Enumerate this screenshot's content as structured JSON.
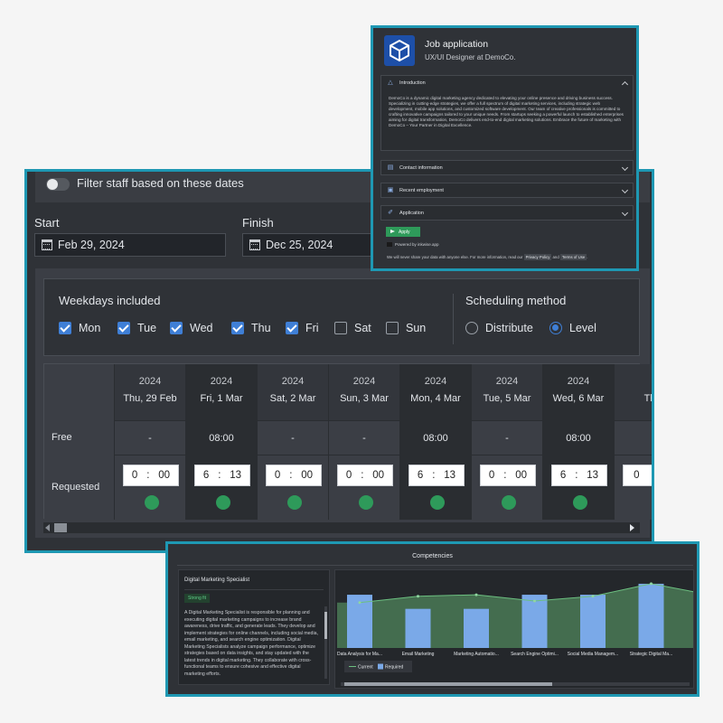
{
  "scheduler": {
    "filter_label": "Filter staff based on these dates",
    "start_label": "Start",
    "start_value": "Feb 29, 2024",
    "finish_label": "Finish",
    "finish_value": "Dec 25, 2024",
    "weekdays_title": "Weekdays included",
    "weekdays": [
      {
        "label": "Mon",
        "checked": true
      },
      {
        "label": "Tue",
        "checked": true
      },
      {
        "label": "Wed",
        "checked": true
      },
      {
        "label": "Thu",
        "checked": true
      },
      {
        "label": "Fri",
        "checked": true
      },
      {
        "label": "Sat",
        "checked": false
      },
      {
        "label": "Sun",
        "checked": false
      }
    ],
    "method_title": "Scheduling method",
    "methods": [
      {
        "label": "Distribute",
        "selected": false
      },
      {
        "label": "Level",
        "selected": true
      }
    ],
    "row_free": "Free",
    "row_requested": "Requested",
    "days": [
      {
        "year": "2024",
        "date": "Thu, 29 Feb",
        "free": "-",
        "h": "0",
        "m": "00"
      },
      {
        "year": "2024",
        "date": "Fri, 1 Mar",
        "free": "08:00",
        "h": "6",
        "m": "13"
      },
      {
        "year": "2024",
        "date": "Sat, 2 Mar",
        "free": "-",
        "h": "0",
        "m": "00"
      },
      {
        "year": "2024",
        "date": "Sun, 3 Mar",
        "free": "-",
        "h": "0",
        "m": "00"
      },
      {
        "year": "2024",
        "date": "Mon, 4 Mar",
        "free": "08:00",
        "h": "6",
        "m": "13"
      },
      {
        "year": "2024",
        "date": "Tue, 5 Mar",
        "free": "-",
        "h": "0",
        "m": "00"
      },
      {
        "year": "2024",
        "date": "Wed, 6 Mar",
        "free": "08:00",
        "h": "6",
        "m": "13"
      },
      {
        "year": "",
        "date": "Th",
        "free": "",
        "h": "0",
        "m": ""
      }
    ]
  },
  "job": {
    "title": "Job application",
    "subtitle": "UX/UI Designer at DemoCo.",
    "intro_title": "Introduction",
    "intro_text": "DemoCo is a dynamic digital marketing agency dedicated to elevating your online presence and driving business success. Specializing in cutting-edge strategies, we offer a full spectrum of digital marketing services, including strategic web development, mobile app solutions, and customized software development. Our team of creative professionals is committed to crafting innovative campaigns tailored to your unique needs. From startups seeking a powerful launch to established enterprises aiming for digital transformation, DemoCo delivers end-to-end digital marketing solutions. Embrace the future of marketing with DemoCo – Your Partner in Digital Excellence.",
    "sections": [
      "Contact information",
      "Recent employment",
      "Application"
    ],
    "apply_label": "Apply",
    "powered_by": "Powered by inkwise.app",
    "privacy_text": "We will never share your data with anyone else. For more information, read our",
    "privacy_link": "Privacy Policy",
    "and_text": "and",
    "terms_link": "Terms of Use",
    "end_text": "."
  },
  "competencies": {
    "title": "Competencies",
    "card_title": "Digital Marketing Specialist",
    "badge": "Strong fit",
    "description": "A Digital Marketing Specialist is responsible for planning and executing digital marketing campaigns to increase brand awareness, drive traffic, and generate leads. They develop and implement strategies for online channels, including social media, email marketing, and search engine optimization. Digital Marketing Specialists analyze campaign performance, optimize strategies based on data insights, and stay updated with the latest trends in digital marketing. They collaborate with cross-functional teams to ensure cohesive and effective digital marketing efforts."
  },
  "chart_data": {
    "type": "bar",
    "title": "",
    "categories": [
      "Data Analysis for Ma...",
      "Email Marketing",
      "Marketing Automatio...",
      "Search Engine Optimi...",
      "Social Media Managem...",
      "Strategic Digital Ma...",
      ""
    ],
    "series": [
      {
        "name": "Current",
        "type": "area",
        "values": [
          2.9,
          3.3,
          3.4,
          3.0,
          3.3,
          4.1,
          3.4
        ]
      },
      {
        "name": "Required",
        "type": "bar",
        "values": [
          3.4,
          2.5,
          2.5,
          3.4,
          3.4,
          4.1,
          null
        ]
      }
    ],
    "ylim": [
      0,
      4.5
    ],
    "legend": "bottom-left",
    "colors": {
      "current": "#4a7a56",
      "required": "#7aa9e8"
    }
  }
}
